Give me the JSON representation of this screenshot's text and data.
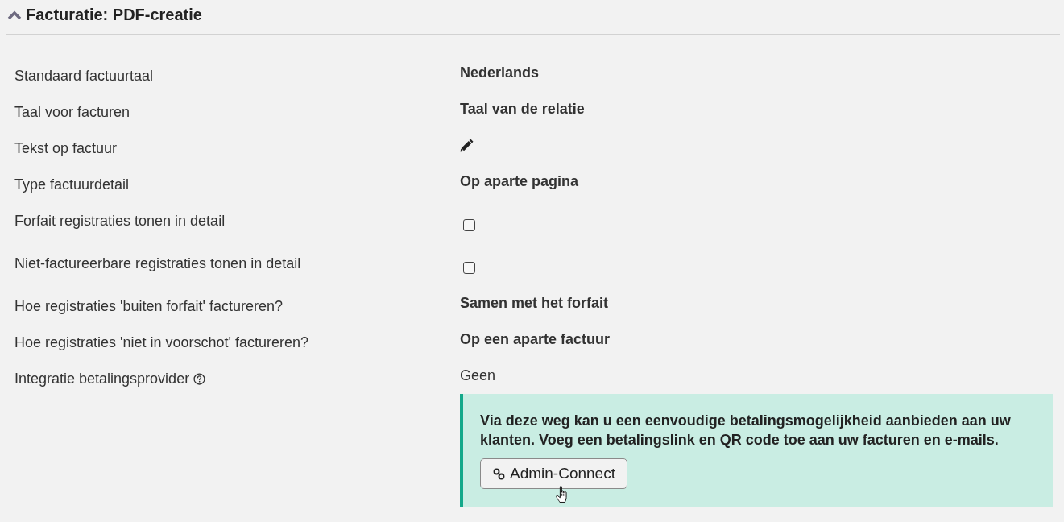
{
  "section": {
    "title": "Facturatie: PDF-creatie",
    "expanded": true
  },
  "settings": [
    {
      "label": "Standaard factuurtaal",
      "kind": "choice",
      "value": "Nederlands"
    },
    {
      "label": "Taal voor facturen",
      "kind": "choice",
      "value": "Taal van de relatie"
    },
    {
      "label": "Tekst op factuur",
      "kind": "edit"
    },
    {
      "label": "Type factuurdetail",
      "kind": "choice",
      "value": "Op aparte pagina"
    },
    {
      "label": "Forfait registraties tonen in detail",
      "kind": "checkbox",
      "checked": false
    },
    {
      "label": "Niet-factureerbare registraties tonen in detail",
      "kind": "checkbox",
      "checked": false
    },
    {
      "label": "Hoe registraties 'buiten forfait' factureren?",
      "kind": "choice",
      "value": "Samen met het forfait"
    },
    {
      "label": "Hoe registraties 'niet in voorschot' factureren?",
      "kind": "choice",
      "value": "Op een aparte factuur"
    },
    {
      "label": "Integratie betalingsprovider",
      "kind": "plain",
      "value": "Geen",
      "help": true
    }
  ],
  "info": {
    "text": "Via deze weg kan u een eenvoudige betalingsmogelijkheid aanbieden aan uw klanten. Voeg een betalingslink en QR code toe aan uw facturen en e-mails.",
    "button": "Admin-Connect"
  }
}
